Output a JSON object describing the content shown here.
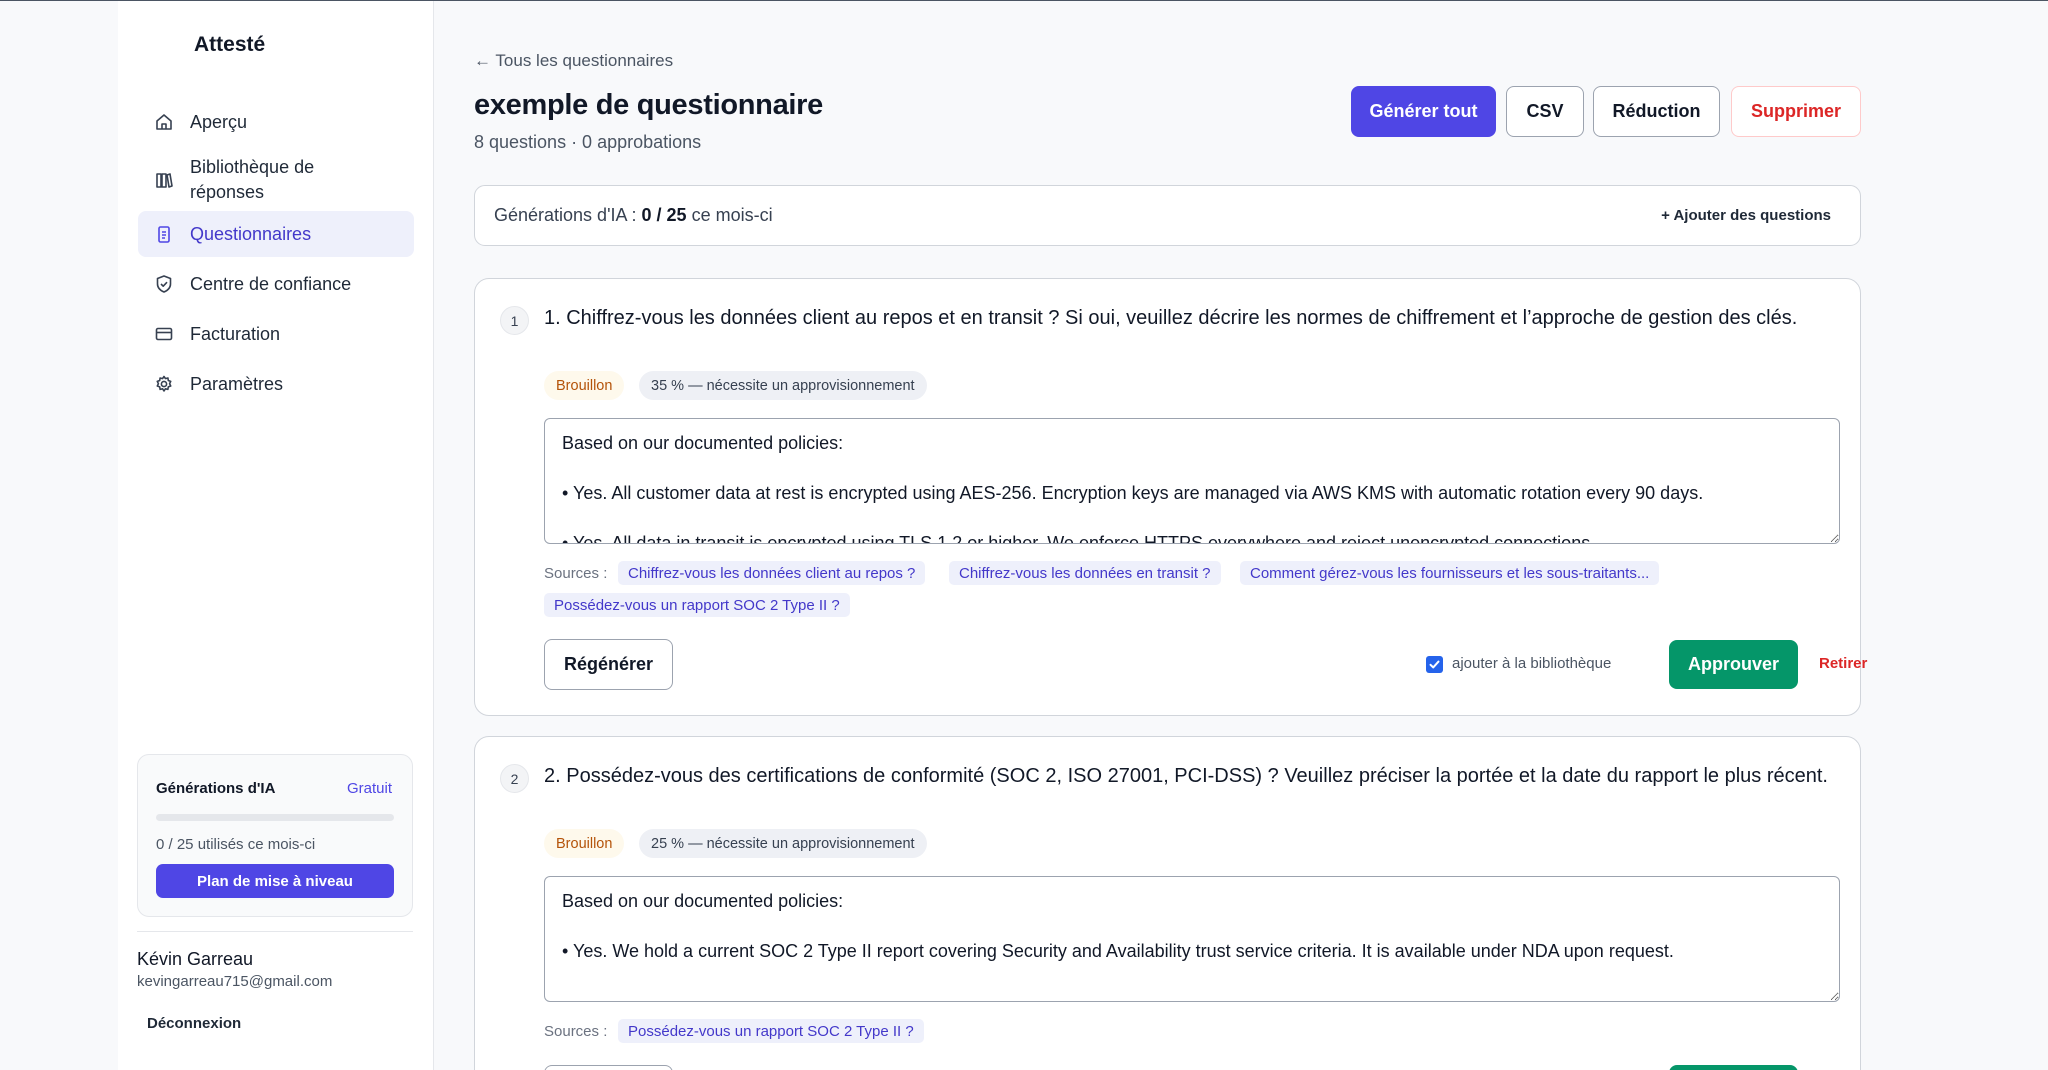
{
  "app": {
    "brand": "Attesté"
  },
  "colors": {
    "accent": "#4f46e5",
    "approve": "#059669",
    "danger": "#dc2626",
    "draft": "#b45309"
  },
  "sidebar": {
    "items": [
      {
        "label": "Aperçu",
        "icon": "home-icon",
        "active": false
      },
      {
        "label": "Bibliothèque de réponses",
        "icon": "library-icon",
        "active": false
      },
      {
        "label": "Questionnaires",
        "icon": "clipboard-icon",
        "active": true
      },
      {
        "label": "Centre de confiance",
        "icon": "shield-check-icon",
        "active": false
      },
      {
        "label": "Facturation",
        "icon": "credit-card-icon",
        "active": false
      },
      {
        "label": "Paramètres",
        "icon": "gear-icon",
        "active": false
      }
    ],
    "usage": {
      "title": "Générations d'IA",
      "plan": "Gratuit",
      "used_fraction": 0,
      "text": "0 / 25 utilisés ce mois-ci",
      "upgrade_label": "Plan de mise à niveau"
    },
    "user": {
      "name": "Kévin Garreau",
      "email": "kevingarreau715@gmail.com",
      "logout_label": "Déconnexion"
    }
  },
  "header": {
    "back_label": "← Tous les questionnaires",
    "title": "exemple de questionnaire",
    "subtitle": "8 questions · 0 approbations",
    "actions": {
      "generate_all": "Générer tout",
      "csv": "CSV",
      "reduction": "Réduction",
      "delete": "Supprimer"
    }
  },
  "quota": {
    "prefix": "Générations d'IA : ",
    "value": "0 / 25",
    "suffix": " ce mois-ci",
    "add_questions": "+ Ajouter des questions"
  },
  "questions": [
    {
      "number": "1",
      "text": "1. Chiffrez-vous les données client au repos et en transit ? Si oui, veuillez décrire les normes de chiffrement et l’approche de gestion des clés.",
      "status": "Brouillon",
      "score": "35 % — nécessite un approvisionnement",
      "answer": "Based on our documented policies:\n\n• Yes. All customer data at rest is encrypted using AES-256. Encryption keys are managed via AWS KMS with automatic rotation every 90 days.\n\n• Yes. All data in transit is encrypted using TLS 1.2 or higher. We enforce HTTPS everywhere and reject unencrypted connections.",
      "sources_label": "Sources :",
      "sources": [
        "Chiffrez-vous les données client au repos ?",
        "Chiffrez-vous les données en transit ?",
        "Comment gérez-vous les fournisseurs et les sous-traitants...",
        "Possédez-vous un rapport SOC 2 Type II ?"
      ],
      "regenerate_label": "Régénérer",
      "add_to_library_label": "ajouter à la bibliothèque",
      "add_to_library_checked": true,
      "approve_label": "Approuver",
      "retract_label": "Retirer"
    },
    {
      "number": "2",
      "text": "2. Possédez-vous des certifications de conformité (SOC 2, ISO 27001, PCI-DSS) ? Veuillez préciser la portée et la date du rapport le plus récent.",
      "status": "Brouillon",
      "score": "25 % — nécessite un approvisionnement",
      "answer": "Based on our documented policies:\n\n• Yes. We hold a current SOC 2 Type II report covering Security and Availability trust service criteria. It is available under NDA upon request.",
      "sources_label": "Sources :",
      "sources": [
        "Possédez-vous un rapport SOC 2 Type II ?"
      ]
    }
  ]
}
